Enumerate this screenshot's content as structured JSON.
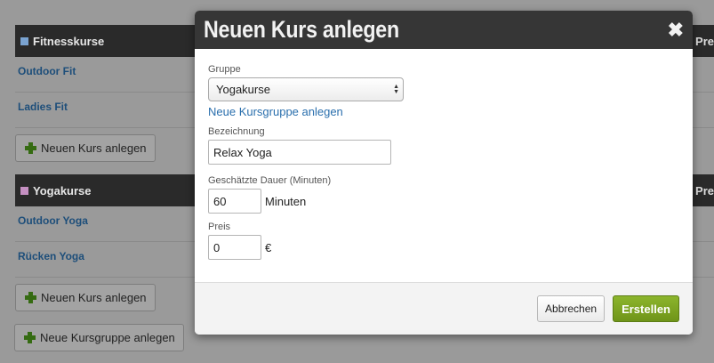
{
  "background": {
    "sections": [
      {
        "title": "Fitnesskurse",
        "color": "#7aa3d1",
        "side_label": "Pre",
        "items": [
          "Outdoor Fit",
          "Ladies Fit"
        ],
        "add_button_label": "Neuen Kurs anlegen"
      },
      {
        "title": "Yogakurse",
        "color": "#c590c2",
        "side_label": "Pre",
        "items": [
          "Outdoor Yoga",
          "Rücken Yoga"
        ],
        "add_button_label": "Neuen Kurs anlegen"
      }
    ],
    "add_group_button_label": "Neue Kursgruppe anlegen"
  },
  "modal": {
    "title": "Neuen Kurs anlegen",
    "close_glyph": "✖",
    "group": {
      "label": "Gruppe",
      "selected": "Yogakurse",
      "new_group_link": "Neue Kursgruppe anlegen"
    },
    "name": {
      "label": "Bezeichnung",
      "value": "Relax Yoga"
    },
    "duration": {
      "label": "Geschätzte Dauer (Minuten)",
      "value": "60",
      "unit": "Minuten"
    },
    "price": {
      "label": "Preis",
      "value": "0",
      "unit": "€"
    },
    "buttons": {
      "cancel": "Abbrechen",
      "create": "Erstellen"
    }
  },
  "colors": {
    "accent_green": "#7aa323",
    "link_blue": "#2a6fad",
    "header_dark": "#363636"
  }
}
